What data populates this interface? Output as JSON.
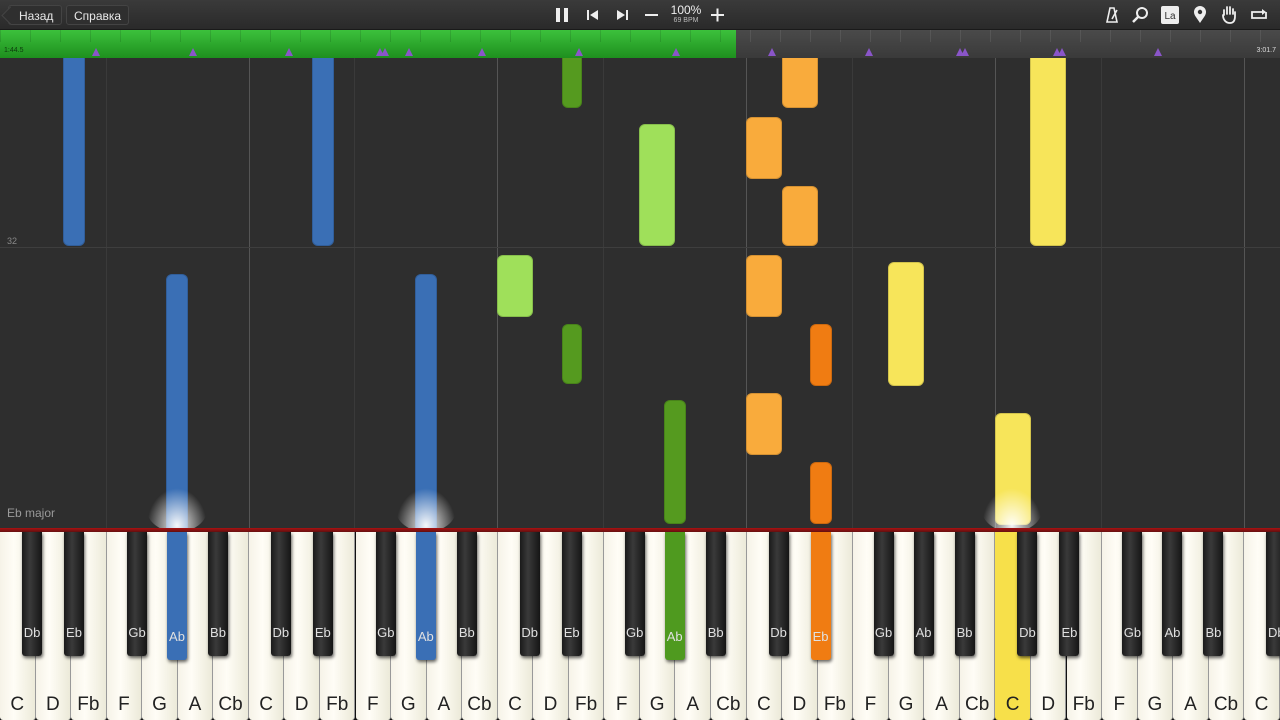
{
  "toolbar": {
    "back_label": "Назад",
    "help_label": "Справка",
    "tempo_percent": "100%",
    "tempo_bpm": "69 BPM",
    "icons": [
      "pause-icon",
      "skip-back-icon",
      "skip-forward-icon",
      "minus-icon",
      "plus-icon",
      "metronome-icon",
      "search-icon",
      "label-la-icon",
      "location-pin-icon",
      "hand-icon",
      "loop-icon"
    ],
    "la_label": "La"
  },
  "progress": {
    "fraction": 0.575,
    "time_start": "1:44.5",
    "time_end": "3:01.7",
    "fill_color": "#2aa92a",
    "marker_color": "#8a55c9"
  },
  "field": {
    "measure_number": "32",
    "key_signature": "Eb major"
  },
  "keyboard": {
    "white_keys": [
      "C",
      "D",
      "Fb",
      "F",
      "G",
      "A",
      "Cb",
      "C",
      "D",
      "Fb",
      "F",
      "G",
      "A",
      "Cb",
      "C",
      "D",
      "Fb",
      "F",
      "G",
      "A",
      "Cb",
      "C",
      "D",
      "Fb",
      "F",
      "G",
      "A",
      "Cb",
      "C",
      "D",
      "Fb",
      "F",
      "G",
      "A",
      "Cb",
      "C"
    ],
    "black_keys": [
      "Db",
      "Eb",
      "Gb",
      "Ab",
      "Bb",
      "Db",
      "Eb",
      "Gb",
      "Ab",
      "Bb",
      "Db",
      "Eb",
      "Gb",
      "Ab",
      "Bb",
      "Db",
      "Eb",
      "Gb",
      "Ab",
      "Bb",
      "Db",
      "Eb",
      "Gb",
      "Ab",
      "Bb",
      "Db",
      "Eb",
      "Gb",
      "Ab",
      "Bb",
      "D"
    ],
    "pressed": [
      {
        "key": "black-3",
        "color": "#3a6fb5"
      },
      {
        "key": "black-8",
        "color": "#3a6fb5"
      },
      {
        "key": "black-13",
        "color": "#4f9a1f"
      },
      {
        "key": "black-16",
        "color": "#f07c12"
      },
      {
        "key": "white-28",
        "color": "#f7e04a"
      }
    ]
  },
  "colors": {
    "blue": "#3a6fb5",
    "light_green": "#9fe05a",
    "dark_green": "#559a1f",
    "light_orange": "#f9ab3c",
    "dark_orange": "#f07c12",
    "yellow": "#f7e55a",
    "toolbar_bg": "#2a2a2a",
    "field_bg": "#2e2e2e"
  }
}
